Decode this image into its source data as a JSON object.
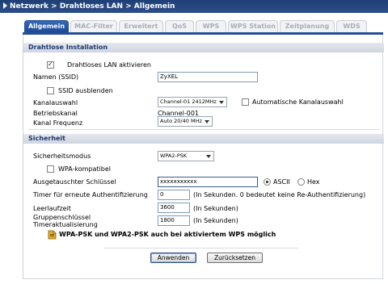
{
  "breadcrumb": "Netzwerk > Drahtloses LAN > Allgemein",
  "tabs": [
    "Allgemein",
    "MAC-Filter",
    "Erweitert",
    "QoS",
    "WPS",
    "WPS Station",
    "Zeitplanung",
    "WDS"
  ],
  "active_tab": 0,
  "install": {
    "section_title": "Drahtlose Installation",
    "enable_wlan_label": "Drahtloses LAN aktivieren",
    "enable_wlan_checked": true,
    "ssid_label": "Namen (SSID)",
    "ssid_value": "ZyXEL",
    "hide_ssid_label": "SSID ausblenden",
    "hide_ssid_checked": false,
    "channel_label": "Kanalauswahl",
    "channel_value": "Channel-01 2412MHz",
    "auto_channel_label": "Automatische Kanalauswahl",
    "auto_channel_checked": false,
    "operating_channel_label": "Betriebskanal",
    "operating_channel_value": "Channel-001",
    "channel_freq_label": "Kanal Frequenz",
    "channel_freq_value": "Auto 20/40 MHz"
  },
  "security": {
    "section_title": "Sicherheit",
    "mode_label": "Sicherheitsmodus",
    "mode_value": "WPA2-PSK",
    "wpa_compat_label": "WPA-kompatibel",
    "wpa_compat_checked": false,
    "psk_label": "Ausgetauschter Schlüssel",
    "psk_value": "xxxxxxxxxxx",
    "ascii_label": "ASCII",
    "hex_label": "Hex",
    "ascii_selected": true,
    "reauth_label": "Timer für erneute Authentifizierung",
    "reauth_value": "0",
    "reauth_hint": "(In Sekunden. 0 bedeutet keine Re-Authentifizierung)",
    "idle_label": "Leerlaufzeit",
    "idle_value": "3600",
    "idle_hint": "(In Sekunden)",
    "group_key_label_1": "Gruppenschlüssel",
    "group_key_label_2": "Timeraktualisierung",
    "group_key_value": "1800",
    "group_key_hint": "(In Sekunden)",
    "note": "WPA-PSK und WPA2-PSK auch bei aktiviertem WPS möglich"
  },
  "buttons": {
    "apply": "Anwenden",
    "reset": "Zurücksetzen"
  },
  "colors": {
    "titlebar": "#244a8a",
    "active_tab": "#2b5bab",
    "section_text": "#1c3770"
  }
}
